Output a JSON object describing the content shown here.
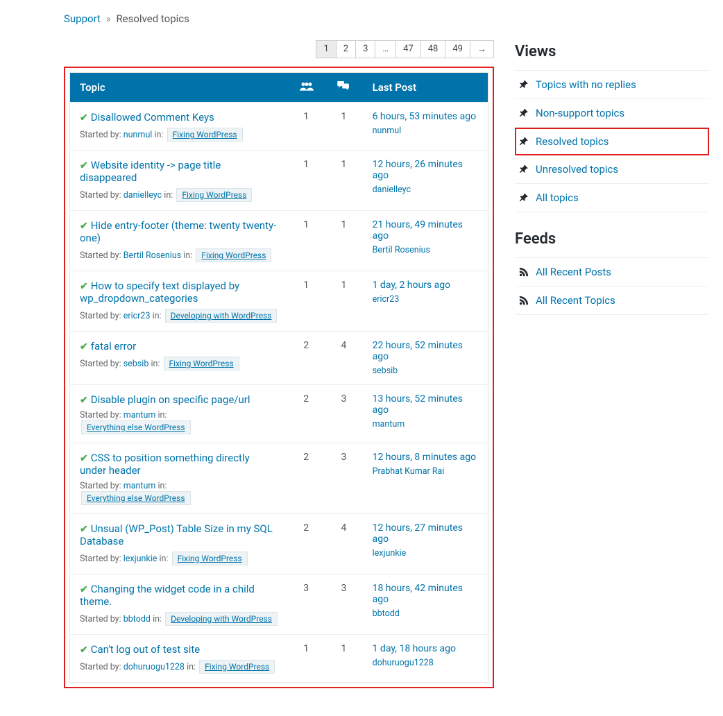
{
  "breadcrumbs": {
    "root": "Support",
    "separator": "»",
    "current": "Resolved topics"
  },
  "pagination": [
    "1",
    "2",
    "3",
    "…",
    "47",
    "48",
    "49",
    "→"
  ],
  "pagination_current": "1",
  "table": {
    "header_topic": "Topic",
    "header_lastpost": "Last Post",
    "started_by_label": "Started by:",
    "in_label": "in:"
  },
  "topics": [
    {
      "title": "Disallowed Comment Keys",
      "starter": "nunmul",
      "forum": "Fixing WordPress",
      "voices": "1",
      "replies": "1",
      "last_time": "6 hours, 53 minutes ago",
      "last_user": "nunmul"
    },
    {
      "title": "Website identity -> page title disappeared",
      "starter": "danielleyc",
      "forum": "Fixing WordPress",
      "voices": "1",
      "replies": "1",
      "last_time": "12 hours, 26 minutes ago",
      "last_user": "danielleyc"
    },
    {
      "title": "Hide entry-footer (theme: twenty twenty-one)",
      "starter": "Bertil Rosenius",
      "forum": "Fixing WordPress",
      "voices": "1",
      "replies": "1",
      "last_time": "21 hours, 49 minutes ago",
      "last_user": "Bertil Rosenius"
    },
    {
      "title": "How to specify text displayed by wp_dropdown_categories",
      "starter": "ericr23",
      "forum": "Developing with WordPress",
      "voices": "1",
      "replies": "1",
      "last_time": "1 day, 2 hours ago",
      "last_user": "ericr23"
    },
    {
      "title": "fatal error",
      "starter": "sebsib",
      "forum": "Fixing WordPress",
      "voices": "2",
      "replies": "4",
      "last_time": "22 hours, 52 minutes ago",
      "last_user": "sebsib"
    },
    {
      "title": "Disable plugin on specific page/url",
      "starter": "mantum",
      "forum": "Everything else WordPress",
      "voices": "2",
      "replies": "3",
      "last_time": "13 hours, 52 minutes ago",
      "last_user": "mantum"
    },
    {
      "title": "CSS to position something directly under header",
      "starter": "mantum",
      "forum": "Everything else WordPress",
      "voices": "2",
      "replies": "3",
      "last_time": "12 hours, 8 minutes ago",
      "last_user": "Prabhat Kumar Rai"
    },
    {
      "title": "Unsual (WP_Post) Table Size in my SQL Database",
      "starter": "lexjunkie",
      "forum": "Fixing WordPress",
      "voices": "2",
      "replies": "4",
      "last_time": "12 hours, 27 minutes ago",
      "last_user": "lexjunkie"
    },
    {
      "title": "Changing the widget code in a child theme.",
      "starter": "bbtodd",
      "forum": "Developing with WordPress",
      "voices": "3",
      "replies": "3",
      "last_time": "18 hours, 42 minutes ago",
      "last_user": "bbtodd"
    },
    {
      "title": "Can't log out of test site",
      "starter": "dohuruogu1228",
      "forum": "Fixing WordPress",
      "voices": "1",
      "replies": "1",
      "last_time": "1 day, 18 hours ago",
      "last_user": "dohuruogu1228"
    }
  ],
  "sidebar": {
    "views_title": "Views",
    "feeds_title": "Feeds",
    "views": [
      {
        "label": "Topics with no replies",
        "highlight": false
      },
      {
        "label": "Non-support topics",
        "highlight": false
      },
      {
        "label": "Resolved topics",
        "highlight": true
      },
      {
        "label": "Unresolved topics",
        "highlight": false
      },
      {
        "label": "All topics",
        "highlight": false
      }
    ],
    "feeds": [
      {
        "label": "All Recent Posts"
      },
      {
        "label": "All Recent Topics"
      }
    ]
  }
}
